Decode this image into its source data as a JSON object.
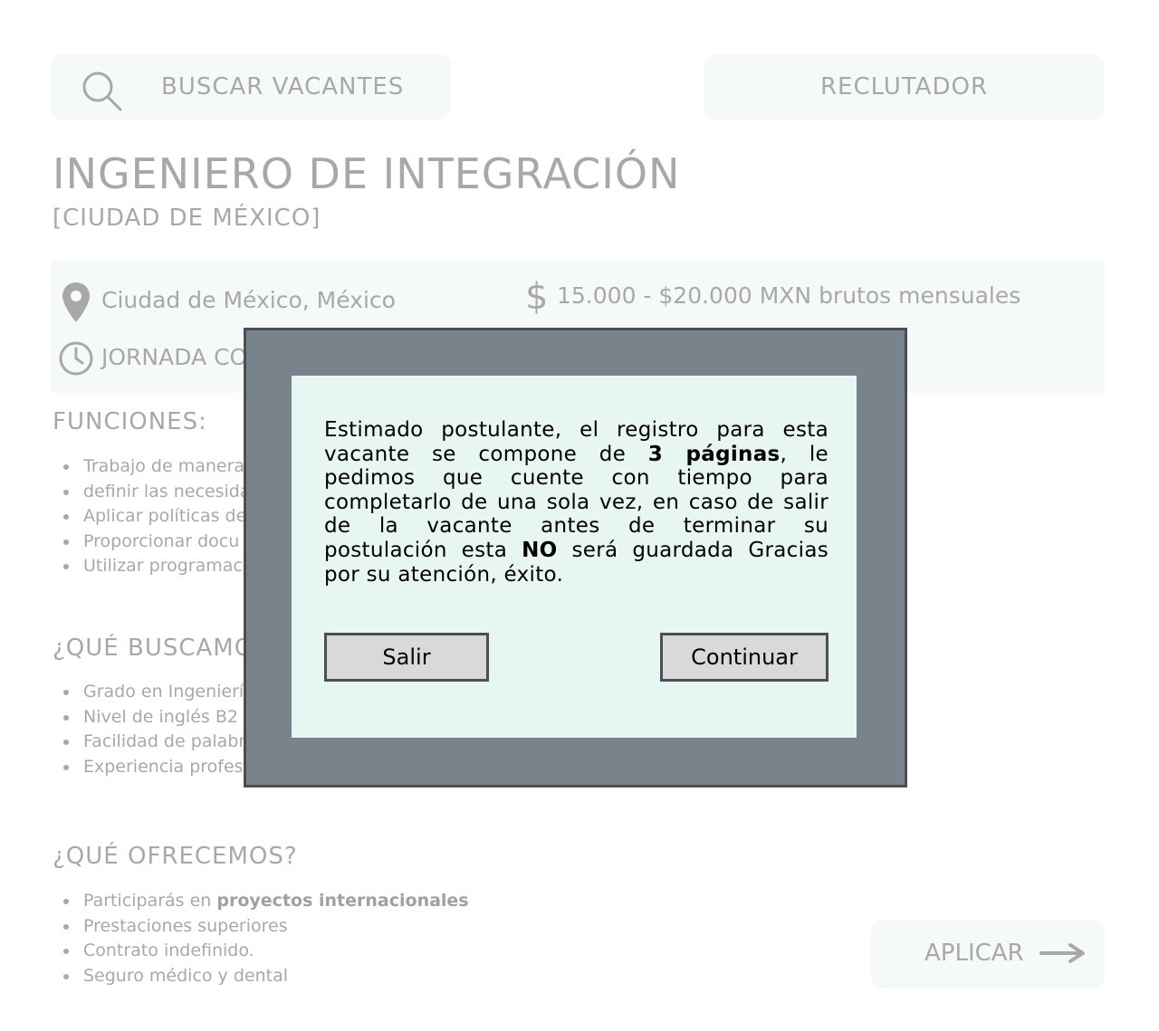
{
  "header": {
    "search_label": "BUSCAR VACANTES",
    "recruiter_label": "RECLUTADOR"
  },
  "job": {
    "title": "INGENIERO DE INTEGRACIÓN",
    "city": "[CIUDAD DE MÉXICO]",
    "location": "Ciudad de México, México",
    "salary_symbol": "$",
    "salary": "15.000 - $20.000 MXN brutos mensuales",
    "schedule_visible": "JORNADA CO"
  },
  "sections": {
    "functions": {
      "heading": "FUNCIONES:",
      "items": [
        "Trabajo de manera",
        "definir las necesida",
        "Aplicar políticas de",
        "Proporcionar docu",
        "Utilizar programac"
      ]
    },
    "requirements": {
      "heading": "¿QUÉ BUSCAMO",
      "items": [
        "Grado en Ingenierí",
        "Nivel de inglés B2",
        "Facilidad de palabr",
        "Experiencia profes"
      ]
    },
    "offers": {
      "heading": "¿QUÉ OFRECEMOS?",
      "item1_prefix": "Participarás en ",
      "item1_bold": "proyectos internacionales",
      "items_rest": [
        "Prestaciones superiores",
        "Contrato indefinido.",
        "Seguro médico y dental"
      ]
    }
  },
  "apply": {
    "label": "APLICAR"
  },
  "modal": {
    "message_part1": "Estimado postulante, el registro para esta vacante se compone de ",
    "message_bold1": "3 páginas",
    "message_part2": ", le pedimos que cuente con tiempo para completarlo de una sola vez, en caso de salir de la vacante antes de terminar su postulación esta ",
    "message_bold2": "NO",
    "message_part3": " será guardada Gracias por su atención, éxito.",
    "exit_button": "Salir",
    "continue_button": "Continuar"
  },
  "icons": {
    "search": "search-icon",
    "location": "map-pin-icon",
    "salary": "dollar-icon",
    "schedule": "clock-icon",
    "apply": "arrow-right-icon"
  },
  "colors": {
    "muted_text": "#a8a8a8",
    "pill_background": "#f5faf8",
    "modal_frame": "#79838c",
    "modal_panel": "#e7f6f2",
    "button_background": "#d9d9d9"
  }
}
